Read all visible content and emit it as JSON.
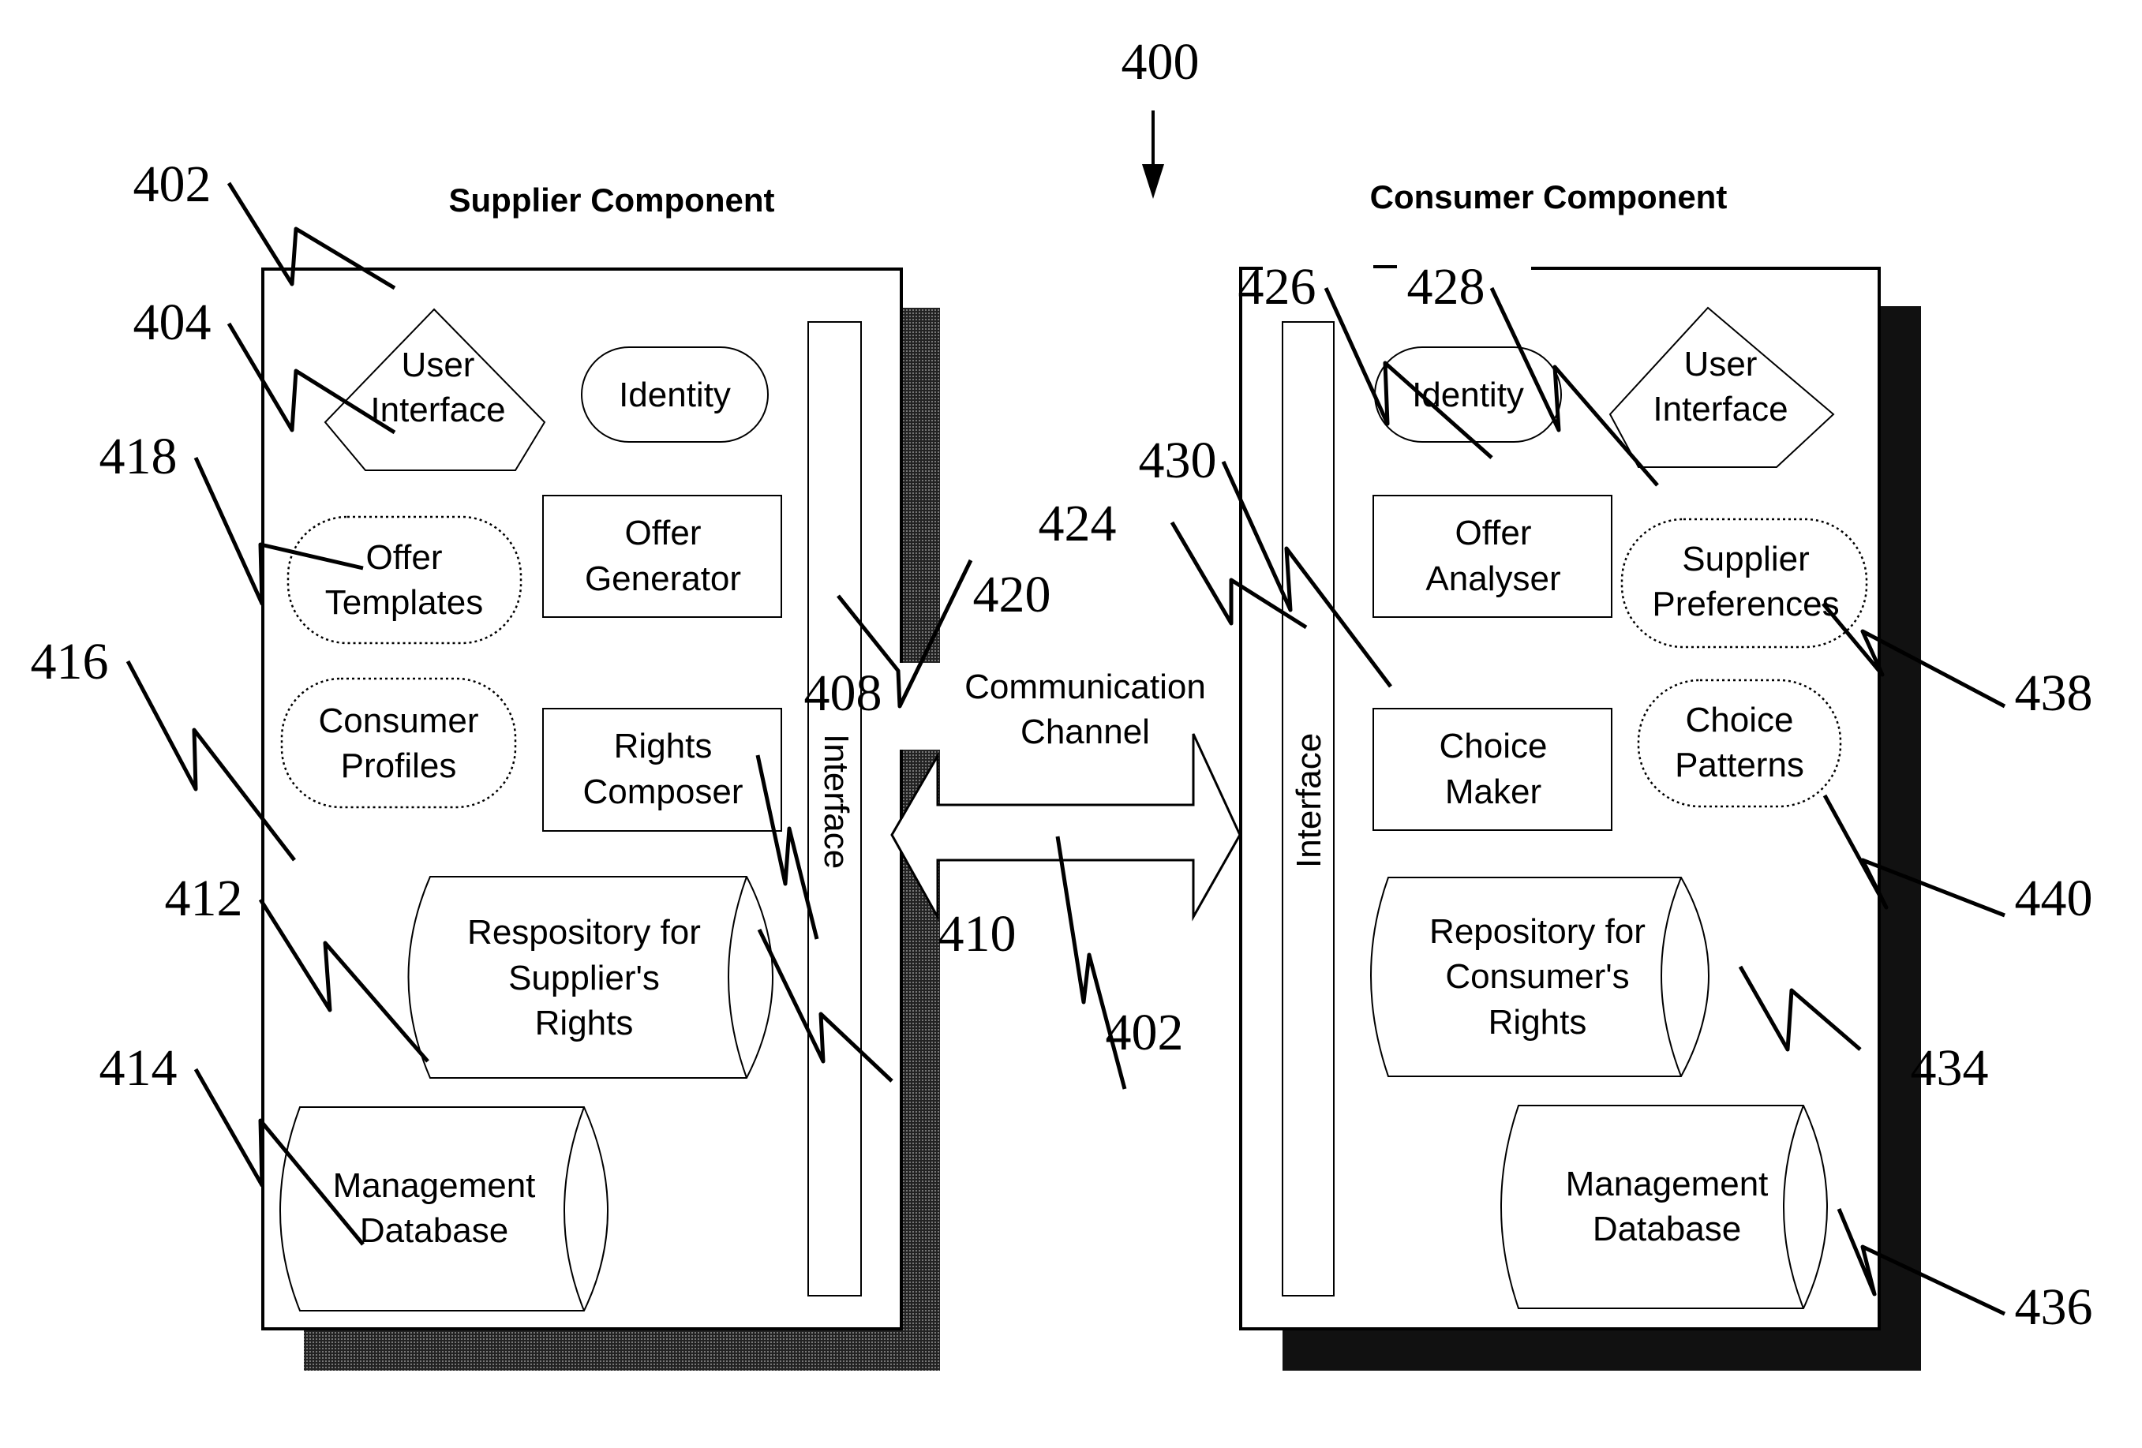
{
  "figure": {
    "ref": "400",
    "channel_ref": "402"
  },
  "supplier": {
    "title": "Supplier Component",
    "ref": "402",
    "user_interface": {
      "lines": [
        "User",
        "Interface"
      ],
      "ref": "404"
    },
    "identity": {
      "label": "Identity"
    },
    "offer_templates": {
      "lines": [
        "Offer",
        "Templates"
      ],
      "ref": "418"
    },
    "offer_generator": {
      "lines": [
        "Offer",
        "Generator"
      ],
      "ref": "408"
    },
    "consumer_profiles": {
      "lines": [
        "Consumer",
        "Profiles"
      ],
      "ref": "416"
    },
    "rights_composer": {
      "lines": [
        "Rights",
        "Composer"
      ],
      "ref": "410"
    },
    "interface": {
      "label": "Interface",
      "ref": "420"
    },
    "repository": {
      "lines": [
        "Respository for",
        "Supplier's",
        "Rights"
      ],
      "ref": "412"
    },
    "database": {
      "lines": [
        "Management",
        "Database"
      ],
      "ref": "414"
    }
  },
  "channel": {
    "lines": [
      "Communication",
      "Channel"
    ]
  },
  "consumer": {
    "title": "Consumer Component",
    "interface": {
      "label": "Interface",
      "ref": "424"
    },
    "identity": {
      "label": "Identity",
      "ref": "426"
    },
    "user_interface": {
      "lines": [
        "User",
        "Interface"
      ],
      "ref": "428"
    },
    "offer_analyser": {
      "lines": [
        "Offer",
        "Analyser"
      ],
      "ref": "430"
    },
    "supplier_preferences": {
      "lines": [
        "Supplier",
        "Preferences"
      ],
      "ref": "438"
    },
    "choice_maker": {
      "lines": [
        "Choice",
        "Maker"
      ]
    },
    "choice_patterns": {
      "lines": [
        "Choice",
        "Patterns"
      ],
      "ref": "440"
    },
    "repository": {
      "lines": [
        "Repository for",
        "Consumer's",
        "Rights"
      ],
      "ref": "434"
    },
    "database": {
      "lines": [
        "Management",
        "Database"
      ],
      "ref": "436"
    }
  }
}
